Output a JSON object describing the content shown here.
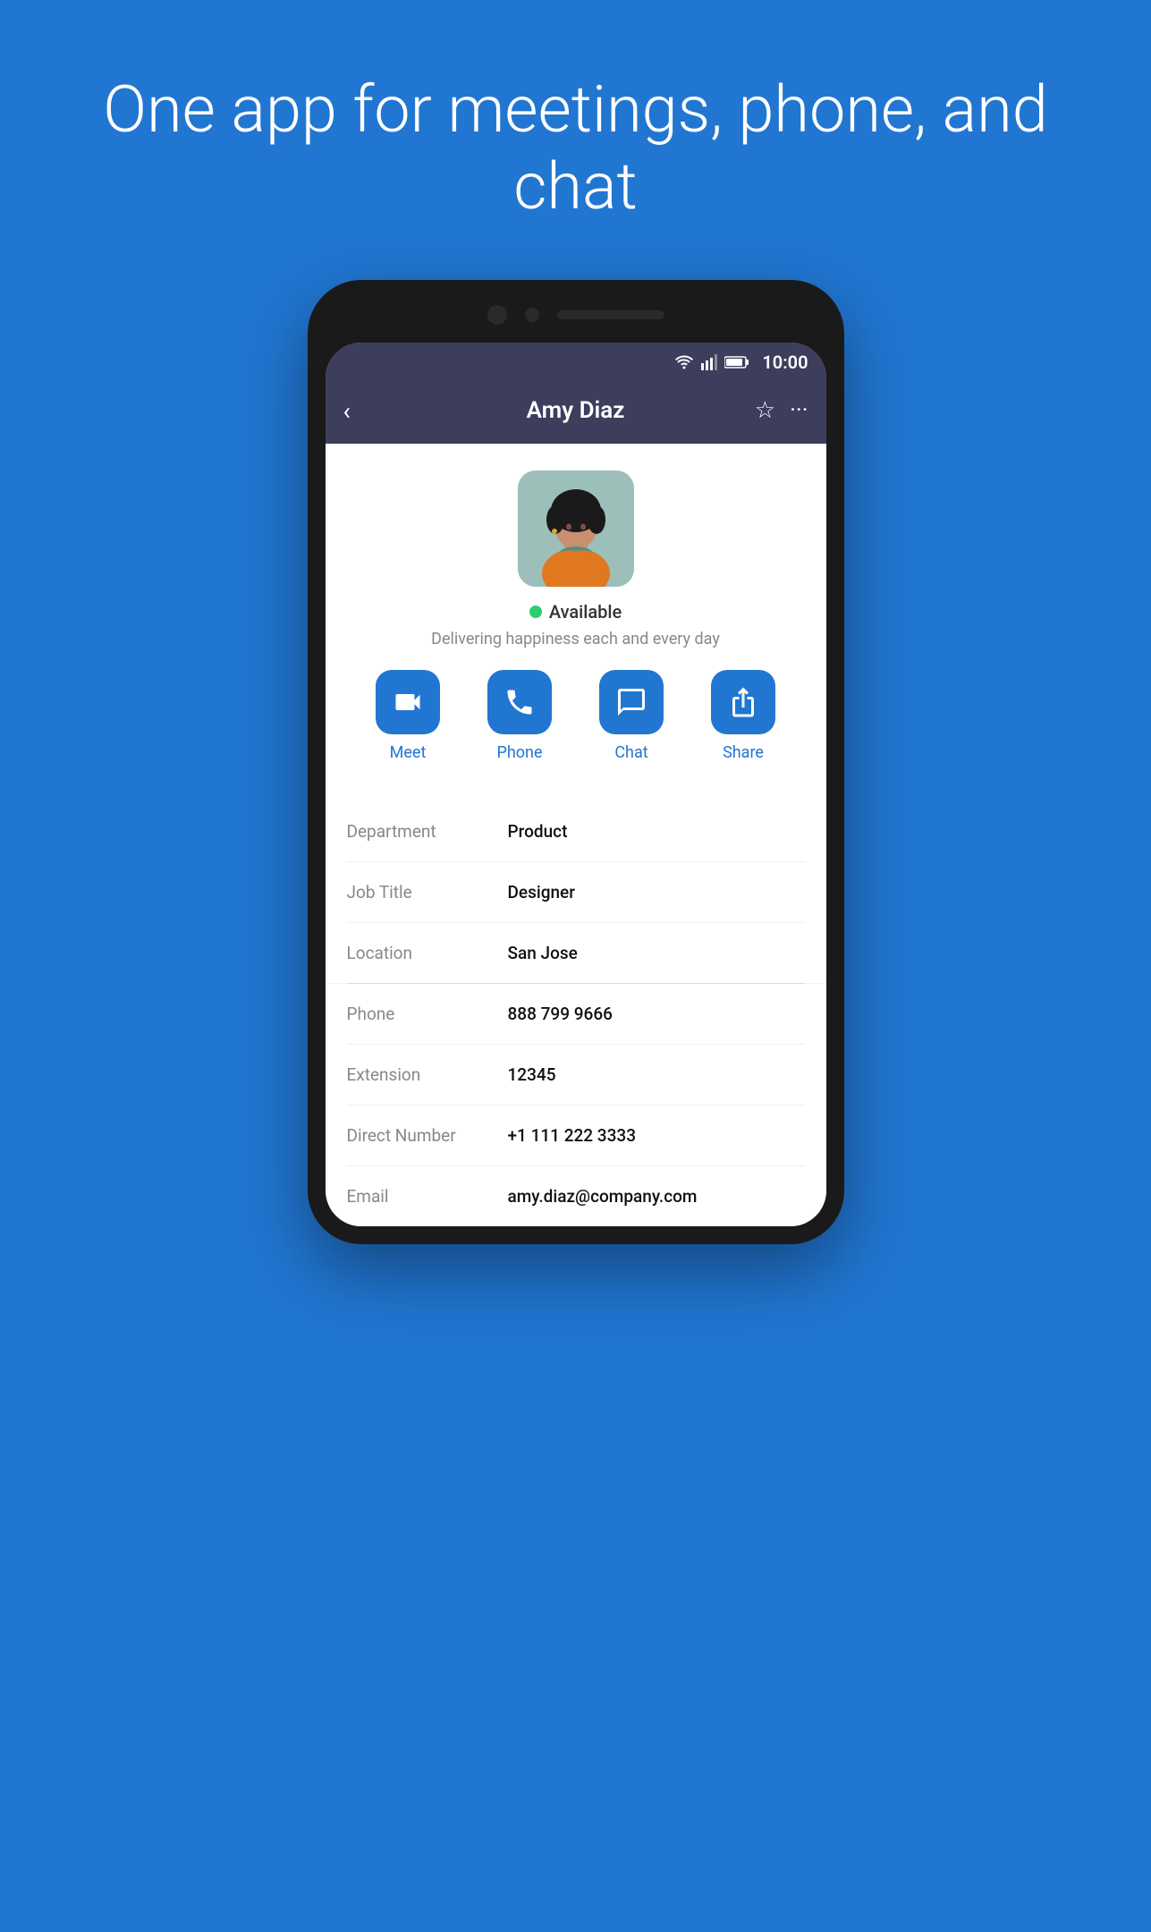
{
  "headline": "One app for meetings, phone, and chat",
  "status_bar": {
    "time": "10:00"
  },
  "nav": {
    "title": "Amy Diaz",
    "back_label": "‹",
    "star_label": "☆",
    "more_label": "···"
  },
  "profile": {
    "status_dot_color": "#2ecc71",
    "status": "Available",
    "status_message": "Delivering happiness each and every day"
  },
  "actions": [
    {
      "label": "Meet",
      "icon": "meet"
    },
    {
      "label": "Phone",
      "icon": "phone"
    },
    {
      "label": "Chat",
      "icon": "chat"
    },
    {
      "label": "Share",
      "icon": "share"
    }
  ],
  "info_rows_personal": [
    {
      "label": "Department",
      "value": "Product"
    },
    {
      "label": "Job Title",
      "value": "Designer"
    },
    {
      "label": "Location",
      "value": "San Jose"
    }
  ],
  "info_rows_contact": [
    {
      "label": "Phone",
      "value": "888 799 9666"
    },
    {
      "label": "Extension",
      "value": "12345"
    },
    {
      "label": "Direct Number",
      "value": "+1 111 222 3333"
    },
    {
      "label": "Email",
      "value": "amy.diaz@company.com"
    }
  ]
}
